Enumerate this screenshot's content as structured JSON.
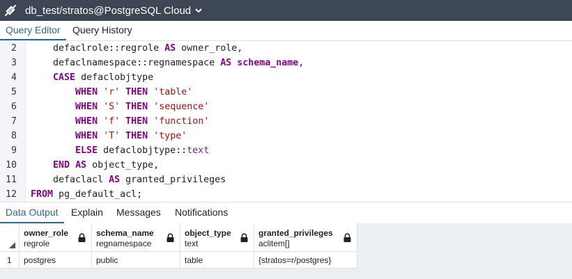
{
  "title_bar": {
    "connection_title": "db_test/stratos@PostgreSQL Cloud",
    "connection_icon": "plug-icon",
    "dropdown_icon": "chevron-down-icon"
  },
  "query_tabs": [
    {
      "label": "Query Editor",
      "active": true
    },
    {
      "label": "Query History",
      "active": false
    }
  ],
  "editor": {
    "lines": [
      {
        "num": "2",
        "code": [
          {
            "t": "    defaclrole::regrole ",
            "c": ""
          },
          {
            "t": "AS",
            "c": "kw"
          },
          {
            "t": " owner_role,",
            "c": ""
          }
        ]
      },
      {
        "num": "3",
        "code": [
          {
            "t": "    defaclnamespace::regnamespace ",
            "c": ""
          },
          {
            "t": "AS",
            "c": "kw"
          },
          {
            "t": " ",
            "c": ""
          },
          {
            "t": "schema_name",
            "c": "kw"
          },
          {
            "t": ",",
            "c": ""
          }
        ]
      },
      {
        "num": "4",
        "code": [
          {
            "t": "    ",
            "c": ""
          },
          {
            "t": "CASE",
            "c": "kw"
          },
          {
            "t": " defaclobjtype",
            "c": ""
          }
        ]
      },
      {
        "num": "5",
        "code": [
          {
            "t": "        ",
            "c": ""
          },
          {
            "t": "WHEN",
            "c": "kw"
          },
          {
            "t": " ",
            "c": ""
          },
          {
            "t": "'r'",
            "c": "str"
          },
          {
            "t": " ",
            "c": ""
          },
          {
            "t": "THEN",
            "c": "kw"
          },
          {
            "t": " ",
            "c": ""
          },
          {
            "t": "'table'",
            "c": "str"
          }
        ]
      },
      {
        "num": "6",
        "code": [
          {
            "t": "        ",
            "c": ""
          },
          {
            "t": "WHEN",
            "c": "kw"
          },
          {
            "t": " ",
            "c": ""
          },
          {
            "t": "'S'",
            "c": "str"
          },
          {
            "t": " ",
            "c": ""
          },
          {
            "t": "THEN",
            "c": "kw"
          },
          {
            "t": " ",
            "c": ""
          },
          {
            "t": "'sequence'",
            "c": "str"
          }
        ]
      },
      {
        "num": "7",
        "code": [
          {
            "t": "        ",
            "c": ""
          },
          {
            "t": "WHEN",
            "c": "kw"
          },
          {
            "t": " ",
            "c": ""
          },
          {
            "t": "'f'",
            "c": "str"
          },
          {
            "t": " ",
            "c": ""
          },
          {
            "t": "THEN",
            "c": "kw"
          },
          {
            "t": " ",
            "c": ""
          },
          {
            "t": "'function'",
            "c": "str"
          }
        ]
      },
      {
        "num": "8",
        "code": [
          {
            "t": "        ",
            "c": ""
          },
          {
            "t": "WHEN",
            "c": "kw"
          },
          {
            "t": " ",
            "c": ""
          },
          {
            "t": "'T'",
            "c": "str"
          },
          {
            "t": " ",
            "c": ""
          },
          {
            "t": "THEN",
            "c": "kw"
          },
          {
            "t": " ",
            "c": ""
          },
          {
            "t": "'type'",
            "c": "str"
          }
        ]
      },
      {
        "num": "9",
        "code": [
          {
            "t": "        ",
            "c": ""
          },
          {
            "t": "ELSE",
            "c": "kw"
          },
          {
            "t": " defaclobjtype::",
            "c": ""
          },
          {
            "t": "text",
            "c": "ty"
          }
        ]
      },
      {
        "num": "10",
        "code": [
          {
            "t": "    ",
            "c": ""
          },
          {
            "t": "END",
            "c": "kw"
          },
          {
            "t": " ",
            "c": ""
          },
          {
            "t": "AS",
            "c": "kw"
          },
          {
            "t": " object_type,",
            "c": ""
          }
        ]
      },
      {
        "num": "11",
        "code": [
          {
            "t": "    defaclacl ",
            "c": ""
          },
          {
            "t": "AS",
            "c": "kw"
          },
          {
            "t": " granted_privileges",
            "c": ""
          }
        ]
      },
      {
        "num": "12",
        "code": [
          {
            "t": "FROM",
            "c": "kw"
          },
          {
            "t": " pg_default_acl;",
            "c": ""
          }
        ]
      }
    ]
  },
  "output_tabs": [
    {
      "label": "Data Output",
      "active": true
    },
    {
      "label": "Explain",
      "active": false
    },
    {
      "label": "Messages",
      "active": false
    },
    {
      "label": "Notifications",
      "active": false
    }
  ],
  "result_grid": {
    "columns": [
      {
        "name": "owner_role",
        "type": "regrole",
        "icon": "lock-icon"
      },
      {
        "name": "schema_name",
        "type": "regnamespace",
        "icon": "lock-icon"
      },
      {
        "name": "object_type",
        "type": "text",
        "icon": "lock-icon"
      },
      {
        "name": "granted_privileges",
        "type": "aclitem[]",
        "icon": "lock-icon"
      }
    ],
    "rows": [
      {
        "num": "1",
        "cells": [
          "postgres",
          "public",
          "table",
          "{stratos=r/postgres}"
        ]
      }
    ]
  },
  "colors": {
    "title_bar_bg": "#3d4654",
    "active_tab": "#326690",
    "keyword": "#8b008b",
    "string": "#aa1111",
    "type": "#7a1f9a"
  }
}
